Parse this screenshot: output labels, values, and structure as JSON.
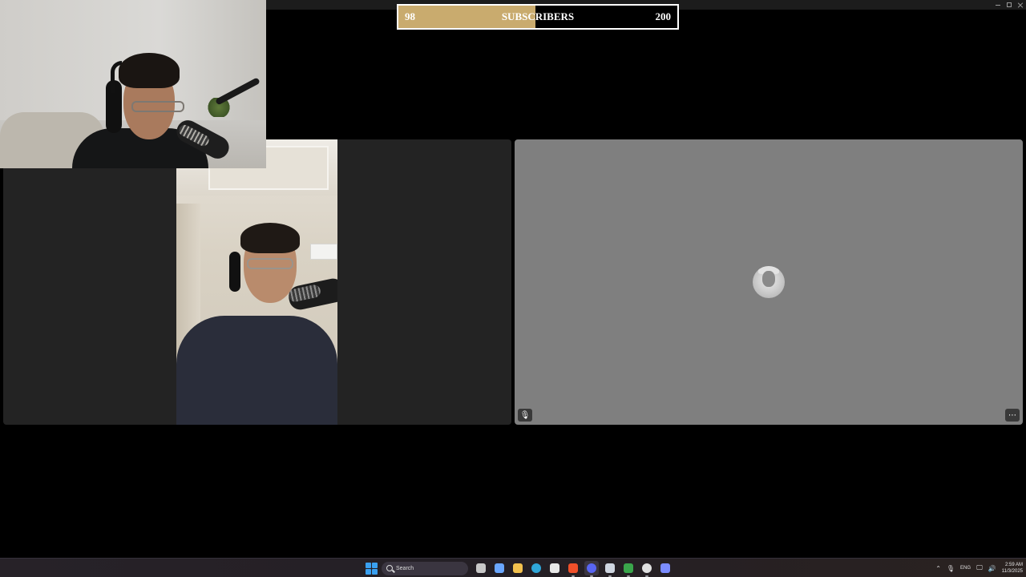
{
  "subscriber_goal": {
    "current": "98",
    "label": "SUBSCRIBERS",
    "target": "200",
    "progress_fraction": 0.49,
    "fill_color": "#c9ab6e"
  },
  "call": {
    "participant_tile_left": {
      "background": "#232323"
    },
    "participant_tile_right": {
      "background": "#7f7f7f",
      "mute_icon": "mic-off-icon",
      "mute_glyph": "🎙",
      "more_icon": "more-options-icon",
      "more_glyph": "⋯"
    }
  },
  "taskbar": {
    "search_placeholder": "Search",
    "apps": [
      {
        "name": "task-view-icon",
        "color": "#c8c8c8"
      },
      {
        "name": "copilot-icon",
        "color": "#6aa7ff"
      },
      {
        "name": "file-explorer-icon",
        "color": "#f2c14e"
      },
      {
        "name": "edge-icon",
        "color": "#2fa6d8"
      },
      {
        "name": "store-icon",
        "color": "#e8e8e8"
      },
      {
        "name": "brave-icon",
        "color": "#f0502a"
      },
      {
        "name": "discord-icon",
        "color": "#5865f2"
      },
      {
        "name": "steam-icon",
        "color": "#cfd6e0"
      },
      {
        "name": "xbox-icon",
        "color": "#3aa64b"
      },
      {
        "name": "chrome-icon",
        "color": "#e0e0e0"
      },
      {
        "name": "app-icon",
        "color": "#7b8cff"
      }
    ],
    "tray": {
      "chevron": "⌃",
      "mic": "🎙",
      "language": "ENG",
      "network": "🖵",
      "volume": "🔊",
      "time": "2:59 AM",
      "date": "11/3/2025"
    }
  }
}
